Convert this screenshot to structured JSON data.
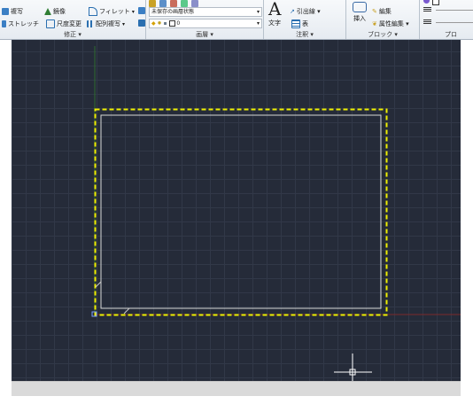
{
  "ribbon": {
    "modify_panel": {
      "items": [
        {
          "label": "複写",
          "icon": "copy-icon"
        },
        {
          "label": "鏡像",
          "icon": "mirror-icon"
        },
        {
          "label": "フィレット",
          "icon": "fillet-icon"
        },
        {
          "label": "ストレッチ",
          "icon": "stretch-icon"
        },
        {
          "label": "尺度変更",
          "icon": "scale-icon"
        },
        {
          "label": "配列複写",
          "icon": "array-icon"
        }
      ],
      "title": "修正 ▾"
    },
    "layers_panel": {
      "layer_state": "未保存の画層状態",
      "current_layer": "0",
      "title": "画層 ▾"
    },
    "annotation_panel": {
      "text_label": "文字",
      "leader_label": "引出線 ▾",
      "table_label": "表",
      "title": "注釈 ▾"
    },
    "block_panel": {
      "insert_label": "挿入",
      "edit_label": "編集",
      "attribute_label": "属性編集 ▾",
      "title": "ブロック ▾"
    },
    "properties_panel": {
      "title": "プロ"
    }
  },
  "colors": {
    "canvas_bg": "#252b39",
    "grid": "#313848",
    "selection": "#f0f000",
    "rectangle": "#d8d8d8",
    "x_axis": "#7a2a2a",
    "y_axis": "#2f6b2f",
    "crosshair": "#ffffff"
  }
}
